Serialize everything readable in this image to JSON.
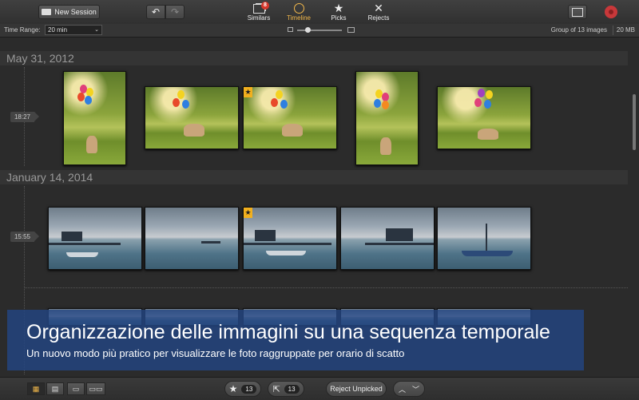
{
  "toolbar": {
    "new_session_label": "New Session",
    "tabs": [
      {
        "label": "Similars",
        "icon": "similars-icon",
        "badge": "8"
      },
      {
        "label": "Timeline",
        "icon": "clock-icon"
      },
      {
        "label": "Picks",
        "icon": "star-icon"
      },
      {
        "label": "Rejects",
        "icon": "x-icon"
      }
    ],
    "active_tab": "Timeline"
  },
  "subbar": {
    "time_range_label": "Time Range:",
    "time_range_value": "20 min",
    "group_info": "Group of 13 images",
    "size": "20 MB"
  },
  "sections": [
    {
      "date": "May 31, 2012",
      "time": "18:27",
      "photos": [
        "park",
        "park",
        "park-starred",
        "park",
        "park"
      ]
    },
    {
      "date": "January 14, 2014",
      "time": "15:55",
      "photos": [
        "sea",
        "sea",
        "sea-starred",
        "sea",
        "sea"
      ]
    }
  ],
  "overlay": {
    "title": "Organizzazione delle immagini su una sequenza temporale",
    "subtitle": "Un nuovo modo più pratico per visualizzare le foto raggruppate per orario di scatto"
  },
  "bottombar": {
    "picks_count": "13",
    "share_count": "13",
    "reject_unpicked_label": "Reject Unpicked"
  },
  "colors": {
    "accent": "#f2b84b",
    "badge": "#d7372c",
    "overlay": "#23468a"
  }
}
